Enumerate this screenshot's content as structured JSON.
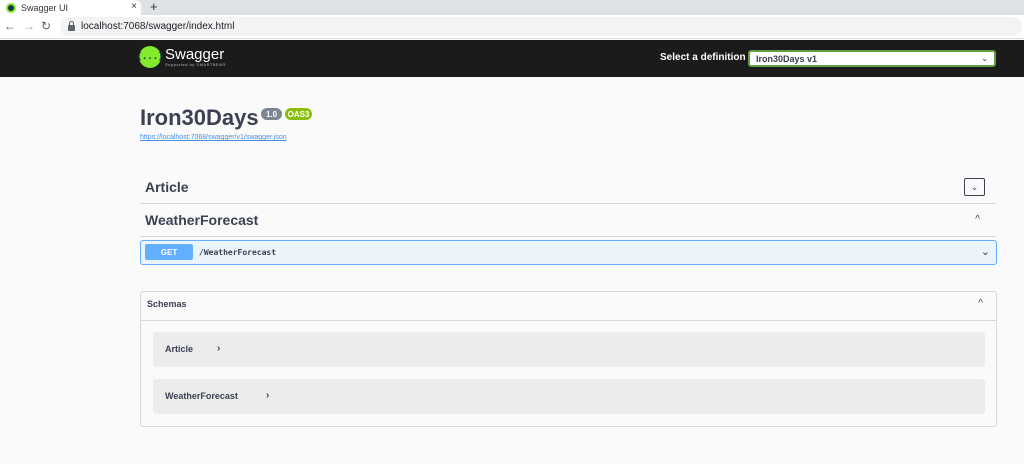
{
  "browser": {
    "tab_title": "Swagger UI",
    "tab_close": "×",
    "new_tab": "+",
    "back": "←",
    "forward": "→",
    "reload": "↻",
    "url": "localhost:7068/swagger/index.html"
  },
  "topbar": {
    "logo_glyph": "{...}",
    "brand": "Swagger",
    "supported_by": "Supported by SMARTBEAR",
    "definition_label": "Select a definition",
    "definition_value": "Iron30Days v1",
    "definition_arrow": "⌄"
  },
  "info": {
    "title": "Iron30Days",
    "version": "1.0",
    "oas": "OAS3",
    "spec_url": "https://localhost:7068/swagger/v1/swagger.json"
  },
  "tags": [
    {
      "name": "Article",
      "chevron": "⌄"
    },
    {
      "name": "WeatherForecast",
      "chevron": "^"
    }
  ],
  "operation": {
    "method": "GET",
    "path": "/WeatherForecast",
    "chevron": "⌄"
  },
  "schemas": {
    "title": "Schemas",
    "chevron": "^",
    "models": [
      {
        "name": "Article",
        "arrow": "›"
      },
      {
        "name": "WeatherForecast",
        "arrow": "›"
      }
    ]
  },
  "colors": {
    "topbar_bg": "#1b1b1b",
    "get_method": "#61affe",
    "oas_badge": "#89bf04",
    "swagger_green": "#85ea2d"
  }
}
